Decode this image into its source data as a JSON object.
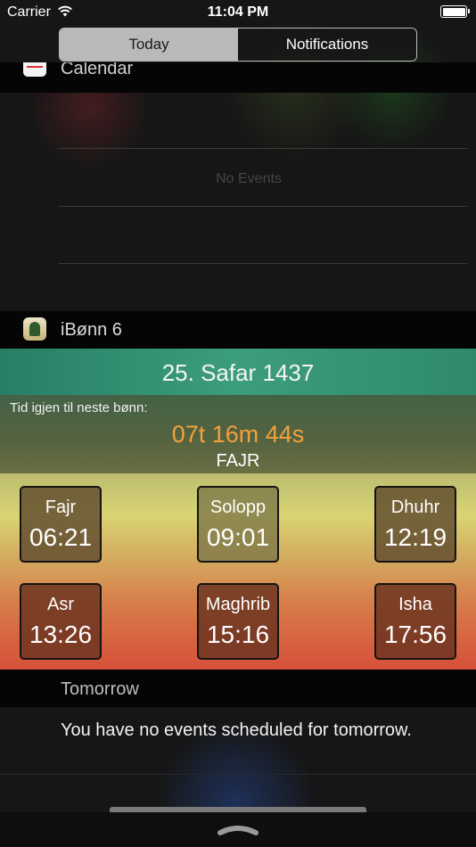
{
  "status_bar": {
    "carrier": "Carrier",
    "time": "11:04 PM"
  },
  "tabs": [
    {
      "label": "Today",
      "active": true
    },
    {
      "label": "Notifications",
      "active": false
    }
  ],
  "calendar": {
    "title": "Calendar",
    "no_events": "No Events"
  },
  "app": {
    "title": "iBønn 6",
    "date": "25. Safar 1437",
    "countdown_label": "Tid igjen til neste bønn:",
    "countdown": "07t 16m 44s",
    "next_prayer": "FAJR",
    "prayers": [
      {
        "name": "Fajr",
        "time": "06:21"
      },
      {
        "name": "Solopp",
        "time": "09:01"
      },
      {
        "name": "Dhuhr",
        "time": "12:19"
      },
      {
        "name": "Asr",
        "time": "13:26"
      },
      {
        "name": "Maghrib",
        "time": "15:16"
      },
      {
        "name": "Isha",
        "time": "17:56"
      }
    ]
  },
  "tomorrow": {
    "title": "Tomorrow",
    "message": "You have no events scheduled for tomorrow."
  },
  "colors": {
    "countdown": "#f4a03a",
    "segment_active": "#b9b9b9"
  }
}
